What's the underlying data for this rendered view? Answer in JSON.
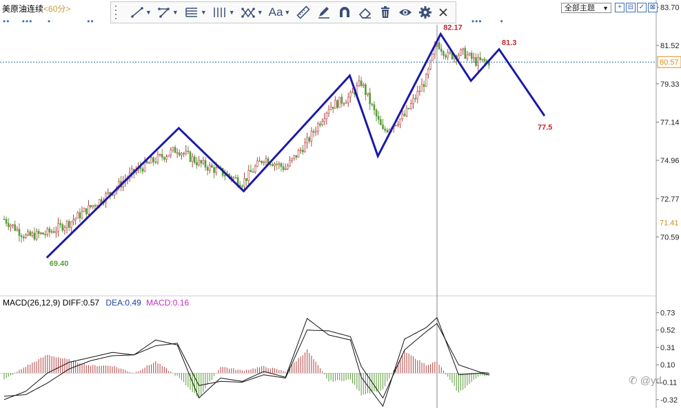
{
  "title": {
    "instrument": "美原油连续",
    "period": "<60分>"
  },
  "theme_selector": {
    "label": "全部主题",
    "arrow": "▼"
  },
  "window_buttons": [
    "+",
    "⊟",
    "✓",
    "⊠"
  ],
  "toolbar": {
    "items": [
      {
        "name": "line-tool-button",
        "icon": "line-icon",
        "dropdown": true
      },
      {
        "name": "polyline-tool-button",
        "icon": "polyline-icon",
        "dropdown": true
      },
      {
        "name": "fib-tool-button",
        "icon": "fibonacci-icon",
        "dropdown": true
      },
      {
        "name": "cycle-tool-button",
        "icon": "cycle-lines-icon",
        "dropdown": true
      },
      {
        "name": "pattern-tool-button",
        "icon": "pattern-icon",
        "dropdown": true
      },
      {
        "name": "text-tool-button",
        "icon": "text-icon",
        "label": "Aa",
        "dropdown": true
      },
      {
        "name": "ruler-tool-button",
        "icon": "ruler-icon"
      },
      {
        "name": "pen-tool-button",
        "icon": "pen-icon"
      },
      {
        "name": "magnet-tool-button",
        "icon": "magnet-icon"
      },
      {
        "name": "eraser-tool-button",
        "icon": "eraser-icon"
      },
      {
        "name": "delete-tool-button",
        "icon": "trash-icon"
      },
      {
        "name": "visibility-tool-button",
        "icon": "eye-icon"
      },
      {
        "name": "settings-tool-button",
        "icon": "gear-icon"
      },
      {
        "name": "close-toolbar-button",
        "icon": "close-icon"
      }
    ],
    "dropdown_glyph": "▼"
  },
  "colors": {
    "zigzag": "#1a1aa8",
    "candle_up": "#b0413e",
    "candle_down": "#5a9a3a",
    "axis_text": "#222222",
    "current_price_line": "#2b6cb0",
    "current_price_label": "#d98c1a",
    "macd_diff": "#111111",
    "macd_dea": "#111111",
    "macd_hist_up": "#b0413e",
    "macd_hist_down": "#5a9a3a",
    "peak_label": "#c0272d",
    "low_label": "#5a9a3a"
  },
  "chart_data": [
    {
      "type": "line",
      "panel": "price",
      "y_ticks": [
        83.7,
        81.52,
        79.33,
        77.14,
        74.96,
        72.77,
        70.59
      ],
      "y_tick_labels": [
        "83.70",
        "81.52",
        "79.33",
        "77.14",
        "74.96",
        "72.77",
        "70.59"
      ],
      "ylim": [
        67.3,
        83.8
      ],
      "bars_visible": 225,
      "price_series": {
        "bar_index": [
          0,
          10,
          20,
          30,
          40,
          50,
          60,
          70,
          80,
          90,
          100,
          110,
          120,
          130,
          140,
          150,
          160,
          165,
          175,
          185,
          195,
          200,
          205,
          212,
          218,
          224
        ],
        "close": [
          71.6,
          70.6,
          70.8,
          71.4,
          72.3,
          73.2,
          74.3,
          75.0,
          75.6,
          74.8,
          74.3,
          73.7,
          75.1,
          74.5,
          76.0,
          78.0,
          78.6,
          79.4,
          76.6,
          77.5,
          79.6,
          81.7,
          80.9,
          81.1,
          80.6,
          80.6
        ]
      },
      "zigzag": {
        "bar_index": [
          20,
          81,
          111,
          160,
          173,
          202,
          216,
          229,
          250
        ],
        "price": [
          69.4,
          76.8,
          73.2,
          79.8,
          75.2,
          82.17,
          79.5,
          81.3,
          77.5
        ],
        "labels": [
          "69.40",
          "",
          "",
          "",
          "",
          "82.17",
          "",
          "81.3",
          "77.5"
        ]
      },
      "current_price": 80.57,
      "current_price_label": "80.57",
      "right_marker": 71.41,
      "right_marker_label": "71.41",
      "crosshair_bar": 200
    },
    {
      "type": "bar",
      "panel": "macd",
      "indicator_label": {
        "name": "MACD(26,12,9)",
        "diff_label": "DIFF:0.57",
        "dea_label": "DEA:0.49",
        "macd_label": "MACD:0.16"
      },
      "y_ticks": [
        0.73,
        0.52,
        0.31,
        0.1,
        -0.11,
        -0.32
      ],
      "y_tick_labels": [
        "0.73",
        "0.52",
        "0.31",
        "0.10",
        "-0.11",
        "-0.32"
      ],
      "ylim": [
        -0.38,
        0.8
      ],
      "diff": {
        "bar_index": [
          0,
          10,
          20,
          30,
          40,
          50,
          60,
          70,
          80,
          90,
          100,
          110,
          120,
          130,
          140,
          150,
          160,
          165,
          175,
          185,
          195,
          200,
          210,
          220,
          224
        ],
        "value": [
          -0.32,
          -0.22,
          0.0,
          0.13,
          0.19,
          0.25,
          0.22,
          0.4,
          0.34,
          -0.3,
          -0.06,
          -0.1,
          0.02,
          -0.05,
          0.66,
          0.46,
          0.4,
          -0.05,
          -0.4,
          0.41,
          0.55,
          0.67,
          -0.02,
          0.0,
          -0.02
        ]
      },
      "dea": {
        "bar_index": [
          0,
          10,
          20,
          30,
          40,
          50,
          60,
          70,
          80,
          90,
          100,
          110,
          120,
          130,
          140,
          150,
          160,
          165,
          175,
          185,
          195,
          200,
          210,
          220,
          224
        ],
        "value": [
          -0.28,
          -0.26,
          -0.12,
          0.05,
          0.15,
          0.21,
          0.22,
          0.33,
          0.36,
          -0.15,
          -0.1,
          -0.11,
          -0.02,
          -0.06,
          0.52,
          0.51,
          0.44,
          0.08,
          -0.3,
          0.28,
          0.5,
          0.6,
          0.1,
          0.01,
          0.0
        ]
      },
      "histogram": {
        "bar_index": [
          0,
          10,
          20,
          30,
          40,
          50,
          60,
          70,
          80,
          90,
          100,
          110,
          120,
          130,
          140,
          150,
          160,
          165,
          175,
          185,
          195,
          200,
          210,
          220,
          224
        ],
        "value": [
          -0.08,
          0.08,
          0.22,
          0.16,
          0.09,
          0.09,
          0.0,
          0.14,
          -0.04,
          -0.3,
          0.08,
          0.03,
          0.08,
          0.02,
          0.28,
          -0.1,
          -0.08,
          -0.26,
          -0.2,
          0.26,
          0.1,
          0.14,
          -0.24,
          -0.02,
          -0.04
        ]
      }
    }
  ],
  "watermark": "✆ @yd"
}
